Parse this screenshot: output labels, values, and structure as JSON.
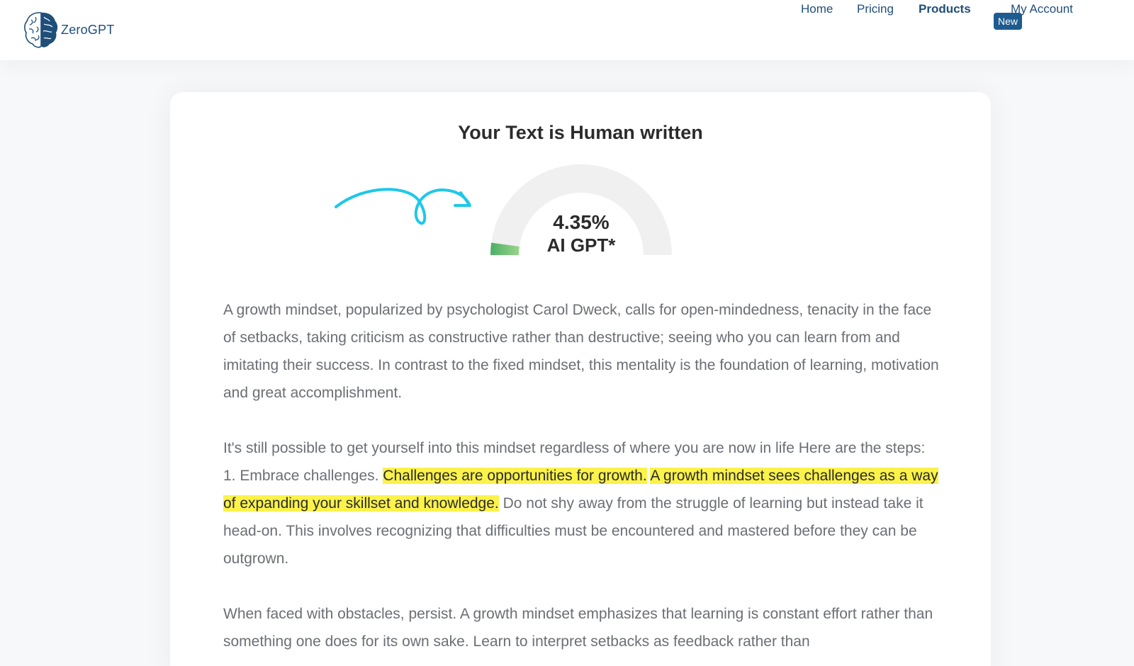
{
  "brand": {
    "name": "ZeroGPT",
    "logo_icon": "brain-icon"
  },
  "nav": {
    "items": [
      {
        "label": "Home",
        "bold": false
      },
      {
        "label": "Pricing",
        "bold": false
      },
      {
        "label": "Products",
        "bold": true
      },
      {
        "label": "My Account",
        "bold": false
      }
    ],
    "products_badge": "New"
  },
  "result": {
    "title": "Your Text is Human written",
    "ai_percent": 4.35,
    "value_label": "4.35%",
    "gauge_label": "AI GPT*",
    "arrow_icon": "curly-arrow-icon"
  },
  "paragraphs": [
    {
      "segments": [
        {
          "text": "A growth mindset, popularized by psychologist Carol Dweck, calls for open-mindedness, tenacity in the face of setbacks, taking criticism as constructive rather than destructive; seeing who you can learn from and imitating their success. In contrast to the fixed mindset, this mentality is the foundation of learning, motivation and great accomplishment.",
          "highlight": false
        }
      ]
    },
    {
      "segments": [
        {
          "text": "It's still possible to get yourself into this mindset regardless of where you are now in life Here are the steps: 1. Embrace challenges. ",
          "highlight": false
        },
        {
          "text": "Challenges are opportunities for growth.",
          "highlight": true
        },
        {
          "text": " ",
          "highlight": false
        },
        {
          "text": "A growth mindset sees challenges as a way of expanding your skillset and knowledge.",
          "highlight": true
        },
        {
          "text": " Do not shy away from the struggle of learning but instead take it head-on. This involves recognizing that difficulties must be encountered and mastered before they can be outgrown.",
          "highlight": false
        }
      ]
    },
    {
      "segments": [
        {
          "text": "When faced with obstacles, persist. A growth mindset emphasizes that learning is constant effort rather than something one does for its own sake. Learn to interpret setbacks as feedback rather than",
          "highlight": false
        }
      ]
    }
  ],
  "colors": {
    "brand_navy": "#1f4e79",
    "badge_bg": "#1e5b8e",
    "highlight": "#fbf24a",
    "gauge_track": "#f0f0f0",
    "gauge_fill_start": "#4cae66",
    "gauge_fill_end": "#9ad58a",
    "arrow": "#1ec8e8"
  }
}
